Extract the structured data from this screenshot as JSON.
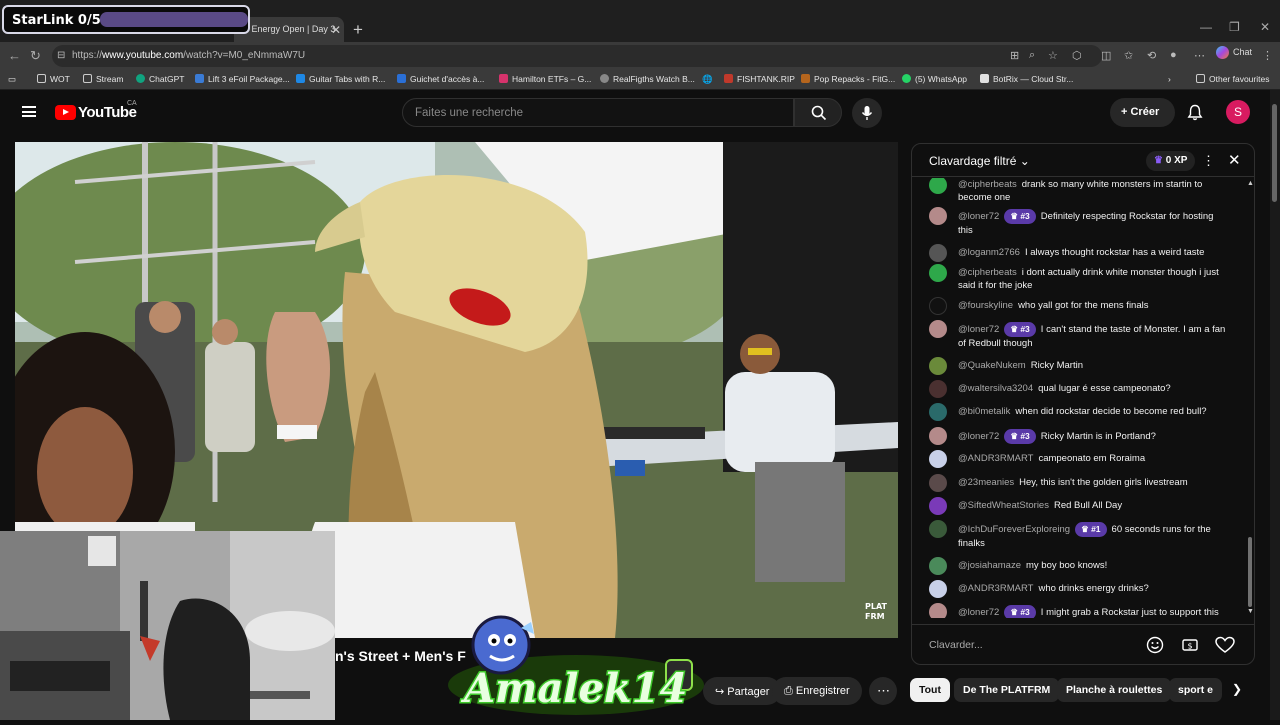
{
  "overlay": {
    "starlink_label": "StarLink 0/50"
  },
  "browser": {
    "active_tab_title": "r Energy Open | Day 3",
    "url_prefix": "https://",
    "url_domain": "www.youtube.com",
    "url_path": "/watch?v=M0_eNmmaW7U",
    "chat_button": "Chat",
    "bookmarks": [
      {
        "label": "WOT",
        "color": "#666"
      },
      {
        "label": "Stream",
        "color": "#666"
      },
      {
        "label": "ChatGPT",
        "color": "#10a37f"
      },
      {
        "label": "Lift 3 eFoil Package...",
        "color": "#3a7bd5"
      },
      {
        "label": "Guitar Tabs with R...",
        "color": "#1e88e5"
      },
      {
        "label": "Guichet d'accès à...",
        "color": "#2a6fd6"
      },
      {
        "label": "Hamilton ETFs – G...",
        "color": "#d6336c"
      },
      {
        "label": "RealFigths Watch B...",
        "color": "#888"
      },
      {
        "label": "",
        "color": "#888"
      },
      {
        "label": "FISHTANK.RIP",
        "color": "#c0392b"
      },
      {
        "label": "Pop Repacks - FitG...",
        "color": "#b5651d"
      },
      {
        "label": "(5) WhatsApp",
        "color": "#25d366"
      },
      {
        "label": "BotRix — Cloud Str...",
        "color": "#e0e0e0"
      }
    ],
    "other_favourites": "Other favourites"
  },
  "youtube": {
    "logo_text": "YouTube",
    "region": "CA",
    "search_placeholder": "Faites une recherche",
    "create_label": "Créer",
    "avatar_letter": "S"
  },
  "video": {
    "title_partial": "n's Street + Men's F",
    "watermark": "PLAT FRM",
    "share_label": "Partager",
    "save_label": "Enregistrer"
  },
  "streamer_logo_text": "Amalek14",
  "chat": {
    "title": "Clavardage filtré",
    "xp": "0 XP",
    "input_placeholder": "Clavarder...",
    "messages": [
      {
        "author": "@cipherbeats",
        "text": "drank so many white monsters im startin to become one",
        "badge": "",
        "avatar_color": "#2ea84a"
      },
      {
        "author": "@loner72",
        "text": "Definitely respecting Rockstar for hosting this",
        "badge": "#3",
        "avatar_color": "#b48a8a"
      },
      {
        "author": "@loganm2766",
        "text": "I always thought rockstar has a weird taste",
        "badge": "",
        "avatar_color": "#555"
      },
      {
        "author": "@cipherbeats",
        "text": "i dont actually drink white monster though i just said it for the joke",
        "badge": "",
        "avatar_color": "#2ea84a"
      },
      {
        "author": "@fourskyline",
        "text": "who yall got for the mens finals",
        "badge": "",
        "avatar_color": "#111"
      },
      {
        "author": "@loner72",
        "text": "I can't stand the taste of Monster. I am a fan of Redbull though",
        "badge": "#3",
        "avatar_color": "#b48a8a"
      },
      {
        "author": "@QuakeNukem",
        "text": "Ricky Martin",
        "badge": "",
        "avatar_color": "#6a8a3a"
      },
      {
        "author": "@waltersilva3204",
        "text": "qual lugar é esse campeonato?",
        "badge": "",
        "avatar_color": "#4a3030"
      },
      {
        "author": "@bi0metalik",
        "text": "when did rockstar decide to become red bull?",
        "badge": "",
        "avatar_color": "#2a6a6a"
      },
      {
        "author": "@loner72",
        "text": "Ricky Martin is in Portland?",
        "badge": "#3",
        "avatar_color": "#b48a8a"
      },
      {
        "author": "@ANDR3RMART",
        "text": "campeonato em Roraima",
        "badge": "",
        "avatar_color": "#c8d0e8"
      },
      {
        "author": "@23meanies",
        "text": "Hey, this isn't the golden girls livestream",
        "badge": "",
        "avatar_color": "#5a4a4a"
      },
      {
        "author": "@SiftedWheatStories",
        "text": "Red Bull All Day",
        "badge": "",
        "avatar_color": "#7a3ab8"
      },
      {
        "author": "@IchDuForeverExploreing",
        "text": "60 seconds runs for the finalks",
        "badge": "#1",
        "avatar_color": "#3a5a3a"
      },
      {
        "author": "@josiahamaze",
        "text": "my boy boo knows!",
        "badge": "",
        "avatar_color": "#4a8a5a"
      },
      {
        "author": "@ANDR3RMART",
        "text": "who drinks energy drinks?",
        "badge": "",
        "avatar_color": "#c8d0e8"
      },
      {
        "author": "@loner72",
        "text": "I might grab a Rockstar just to support this",
        "badge": "#3",
        "avatar_color": "#b48a8a"
      }
    ]
  },
  "chips": [
    {
      "label": "Tout",
      "active": true
    },
    {
      "label": "De The PLATFRM",
      "active": false
    },
    {
      "label": "Planche à roulettes",
      "active": false
    },
    {
      "label": "sport e",
      "active": false
    }
  ]
}
